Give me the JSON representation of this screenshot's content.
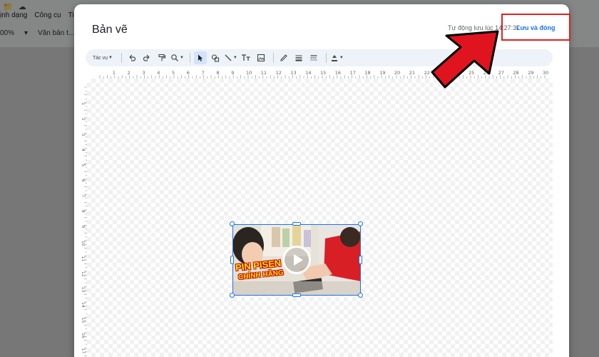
{
  "background": {
    "menu": [
      "ịnh dạng",
      "Công cụ",
      "Tiện íc"
    ],
    "toolbar": {
      "zoom": "00%",
      "style": "Văn bản t..."
    }
  },
  "dialog": {
    "title": "Bản vẽ",
    "autosave": "Tự động lưu lúc 14:27:37",
    "save_close": "Lưu và đóng",
    "toolbar": {
      "actions_label": "Tác vụ",
      "tools": [
        "undo-icon",
        "redo-icon",
        "paint-format-icon",
        "zoom-icon",
        "select-icon",
        "shape-icon",
        "line-icon",
        "text-box-icon",
        "image-icon",
        "pen-icon",
        "line-weight-icon",
        "line-dash-icon",
        "fill-color-icon"
      ]
    },
    "ruler_h": [
      "1",
      "2",
      "3",
      "4",
      "5",
      "6",
      "7",
      "8",
      "9",
      "10",
      "11",
      "12",
      "13",
      "14",
      "15",
      "16",
      "17",
      "18",
      "19",
      "20",
      "21",
      "22",
      "23",
      "24",
      "25",
      "26",
      "27",
      "28",
      "29",
      "30"
    ],
    "ruler_v": [
      "1",
      "2",
      "3",
      "4",
      "5",
      "6",
      "7",
      "8",
      "9",
      "10",
      "11",
      "12",
      "13",
      "14",
      "15",
      "16",
      "17",
      "18",
      "19",
      "20"
    ],
    "video": {
      "caption_line1": "PIN PISEN",
      "caption_line2": "CHÍNH HÃNG",
      "play_icon": "play-icon"
    }
  },
  "annotation": {
    "box_color": "#e02020",
    "arrow_color": "#e0141e"
  }
}
